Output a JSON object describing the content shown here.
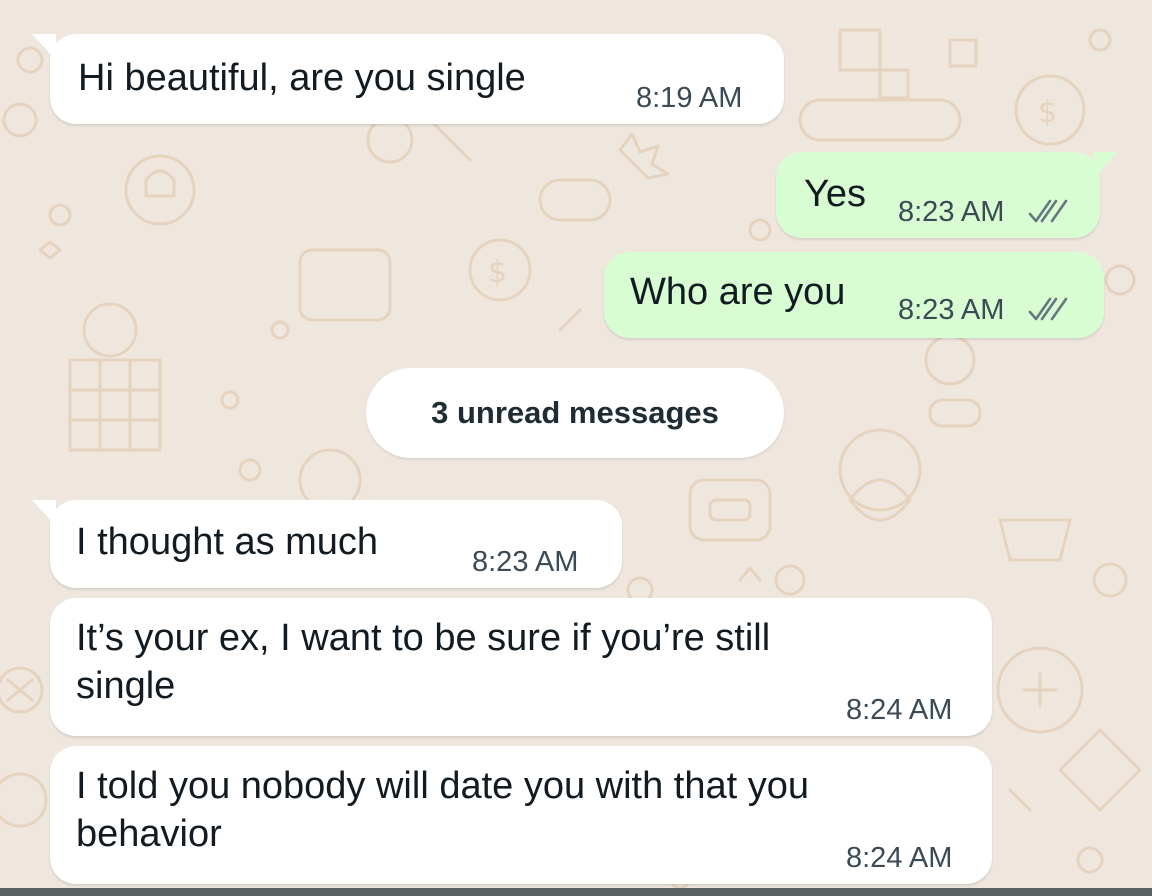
{
  "messages": [
    {
      "direction": "incoming",
      "text": "Hi beautiful, are you single",
      "time": "8:19 AM"
    },
    {
      "direction": "outgoing",
      "text": "Yes",
      "time": "8:23 AM",
      "status": "read"
    },
    {
      "direction": "outgoing",
      "text": "Who are you",
      "time": "8:23 AM",
      "status": "read"
    },
    {
      "direction": "incoming",
      "text": "I thought as much",
      "time": "8:23 AM"
    },
    {
      "direction": "incoming",
      "text": "It’s your ex,  I want to be sure if you’re still\nsingle",
      "time": "8:24 AM"
    },
    {
      "direction": "incoming",
      "text": "I told you nobody will date you with that you\nbehavior",
      "time": "8:24 AM"
    }
  ],
  "unread_divider": {
    "label": "3 unread messages"
  },
  "icons": {
    "read_receipt": "double-check-icon"
  },
  "colors": {
    "wallpaper": "#efe7de",
    "incoming_bubble": "#ffffff",
    "outgoing_bubble": "#d9fdd3",
    "read_ticks": "#667781"
  }
}
